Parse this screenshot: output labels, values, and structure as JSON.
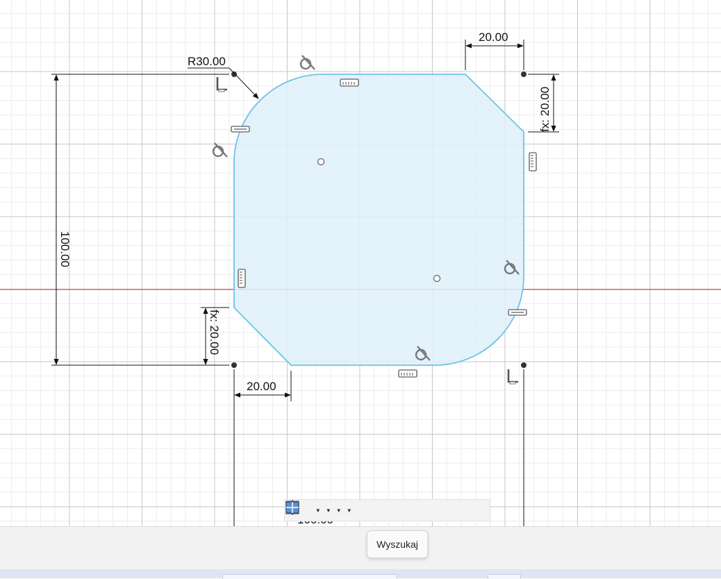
{
  "dimensions": {
    "radius_label": "R30.00",
    "top_chamfer_width": "20.00",
    "right_chamfer_height": "fx: 20.00",
    "height": "100.00",
    "left_chamfer_height": "fx: 20.00",
    "bottom_chamfer_width": "20.00",
    "overall_width_partial": "100.00"
  },
  "colors": {
    "sketch_line": "#6cc3e6",
    "profile_fill": "#dff0fa",
    "axis_line": "#d9534f",
    "grid_major": "#c9c9c9",
    "grid_minor": "#ececec"
  },
  "constraint_icons": [
    "tangent-icon",
    "horizontal-icon",
    "vertical-icon",
    "coincident-icon"
  ],
  "toolbar": {
    "items": [
      "orbit-icon",
      "look-at-icon",
      "pan-icon",
      "zoom-window-icon",
      "zoom-icon",
      "display-settings-icon",
      "grid-settings-icon",
      "viewports-icon"
    ]
  },
  "tooltip": {
    "label": "Wyszukaj"
  }
}
